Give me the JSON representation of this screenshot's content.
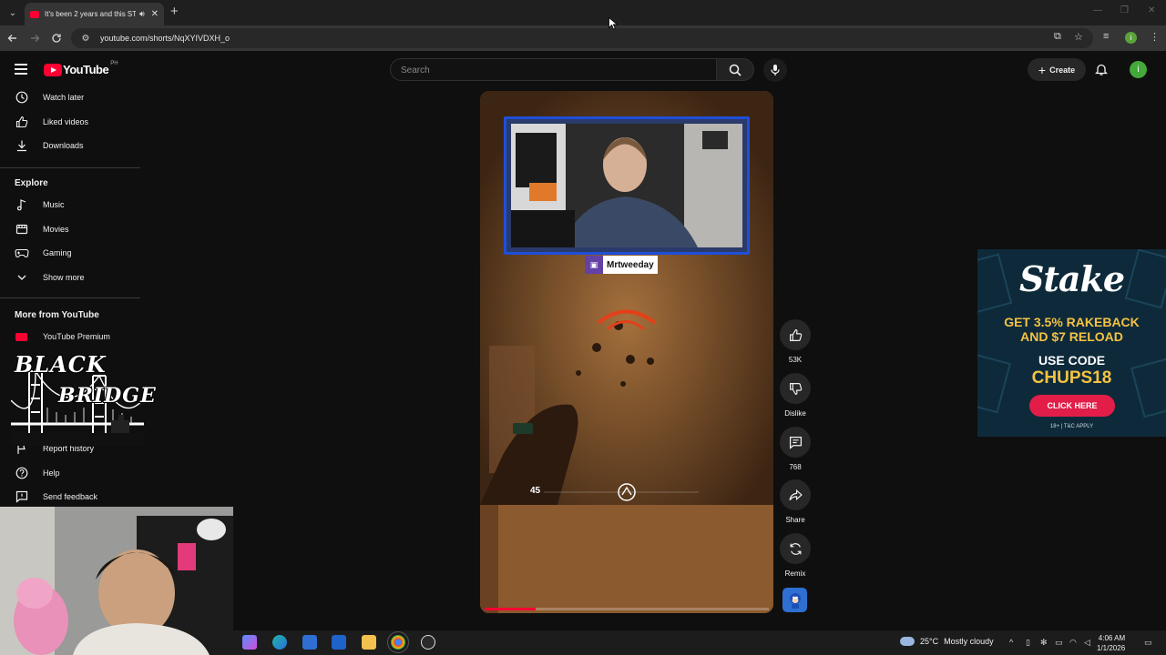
{
  "browser": {
    "tab_title": "It's been 2 years and this ST",
    "tab_menu_icon": "chevron-down-icon",
    "url": "youtube.com/shorts/NqXYIVDXH_o"
  },
  "youtube": {
    "logo_word": "YouTube",
    "country_code": "PH",
    "search_placeholder": "Search",
    "create_label": "Create",
    "avatar_letter": "i"
  },
  "sidebar": {
    "top_items": [
      {
        "label": "Watch later",
        "icon": "clock-icon"
      },
      {
        "label": "Liked videos",
        "icon": "thumbs-up-icon"
      },
      {
        "label": "Downloads",
        "icon": "download-icon"
      }
    ],
    "explore_heading": "Explore",
    "explore_items": [
      {
        "label": "Music",
        "icon": "music-note-icon"
      },
      {
        "label": "Movies",
        "icon": "film-icon"
      },
      {
        "label": "Gaming",
        "icon": "gamepad-icon"
      },
      {
        "label": "Show more",
        "icon": "chevron-down-icon"
      }
    ],
    "more_heading": "More from YouTube",
    "more_items": [
      {
        "label": "YouTube Premium",
        "icon": "youtube-icon"
      }
    ],
    "bottom_items": [
      {
        "label": "Report history",
        "icon": "flag-icon"
      },
      {
        "label": "Help",
        "icon": "help-icon"
      },
      {
        "label": "Send feedback",
        "icon": "feedback-icon"
      }
    ]
  },
  "overlay_logo": {
    "line1": "BLACK",
    "line2": "BRIDGE"
  },
  "short": {
    "streamer_name": "Mrtweeday",
    "hud_ammo": "45",
    "progress_fraction": 0.18
  },
  "actions": {
    "like_count": "53K",
    "dislike_label": "Dislike",
    "comment_count": "768",
    "share_label": "Share",
    "remix_label": "Remix"
  },
  "ad": {
    "brand": "Stake",
    "line1": "GET 3.5% RAKEBACK",
    "line2": "AND $7 RELOAD",
    "line3": "USE CODE",
    "code": "CHUPS18",
    "cta": "CLICK HERE",
    "fine_print": "18+ | T&C APPLY",
    "colors": {
      "bg": "#0e2a3a",
      "accent": "#f5c242",
      "cta": "#e11d48"
    }
  },
  "taskbar": {
    "weather_temp": "25°C",
    "weather_text": "Mostly cloudy",
    "time": "4:06 AM",
    "date": "1/1/2026"
  }
}
